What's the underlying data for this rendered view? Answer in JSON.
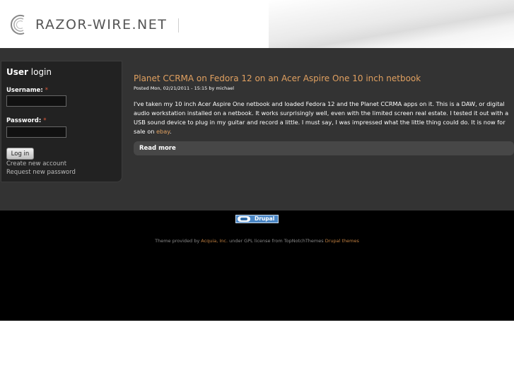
{
  "header": {
    "site_name": "RAZOR-WIRE.NET"
  },
  "login": {
    "title_bold": "User",
    "title_rest": " login",
    "username_label": "Username:",
    "password_label": "Password:",
    "required_mark": "*",
    "username_value": "",
    "password_value": "",
    "login_button": "Log in",
    "create_account": "Create new account",
    "request_password": "Request new password"
  },
  "node": {
    "title": "Planet CCRMA on Fedora 12 on an Acer Aspire One 10 inch netbook",
    "submitted": "Posted Mon, 02/21/2011 - 15:15 by michael",
    "body_text": "I've taken my 10 inch Acer Aspire One netbook and loaded Fedora 12 and the Planet CCRMA apps on it. This is a DAW, or digital audio workstation installed on a netbook. It works surprisingly well, even with the limited screen real estate. I tested it out with a USB sound device to plug in my guitar and record a little. I must say, I was impressed what the little thing could do. It is now for sale on ",
    "body_link": "ebay",
    "body_end": ".",
    "read_more": "Read more"
  },
  "footer": {
    "badge_text": "Drupal",
    "credits_prefix": "Theme provided by ",
    "credits_acquia": "Acquia, Inc.",
    "credits_middle": " under GPL license from TopNotchThemes ",
    "credits_drupal_themes": "Drupal themes"
  }
}
